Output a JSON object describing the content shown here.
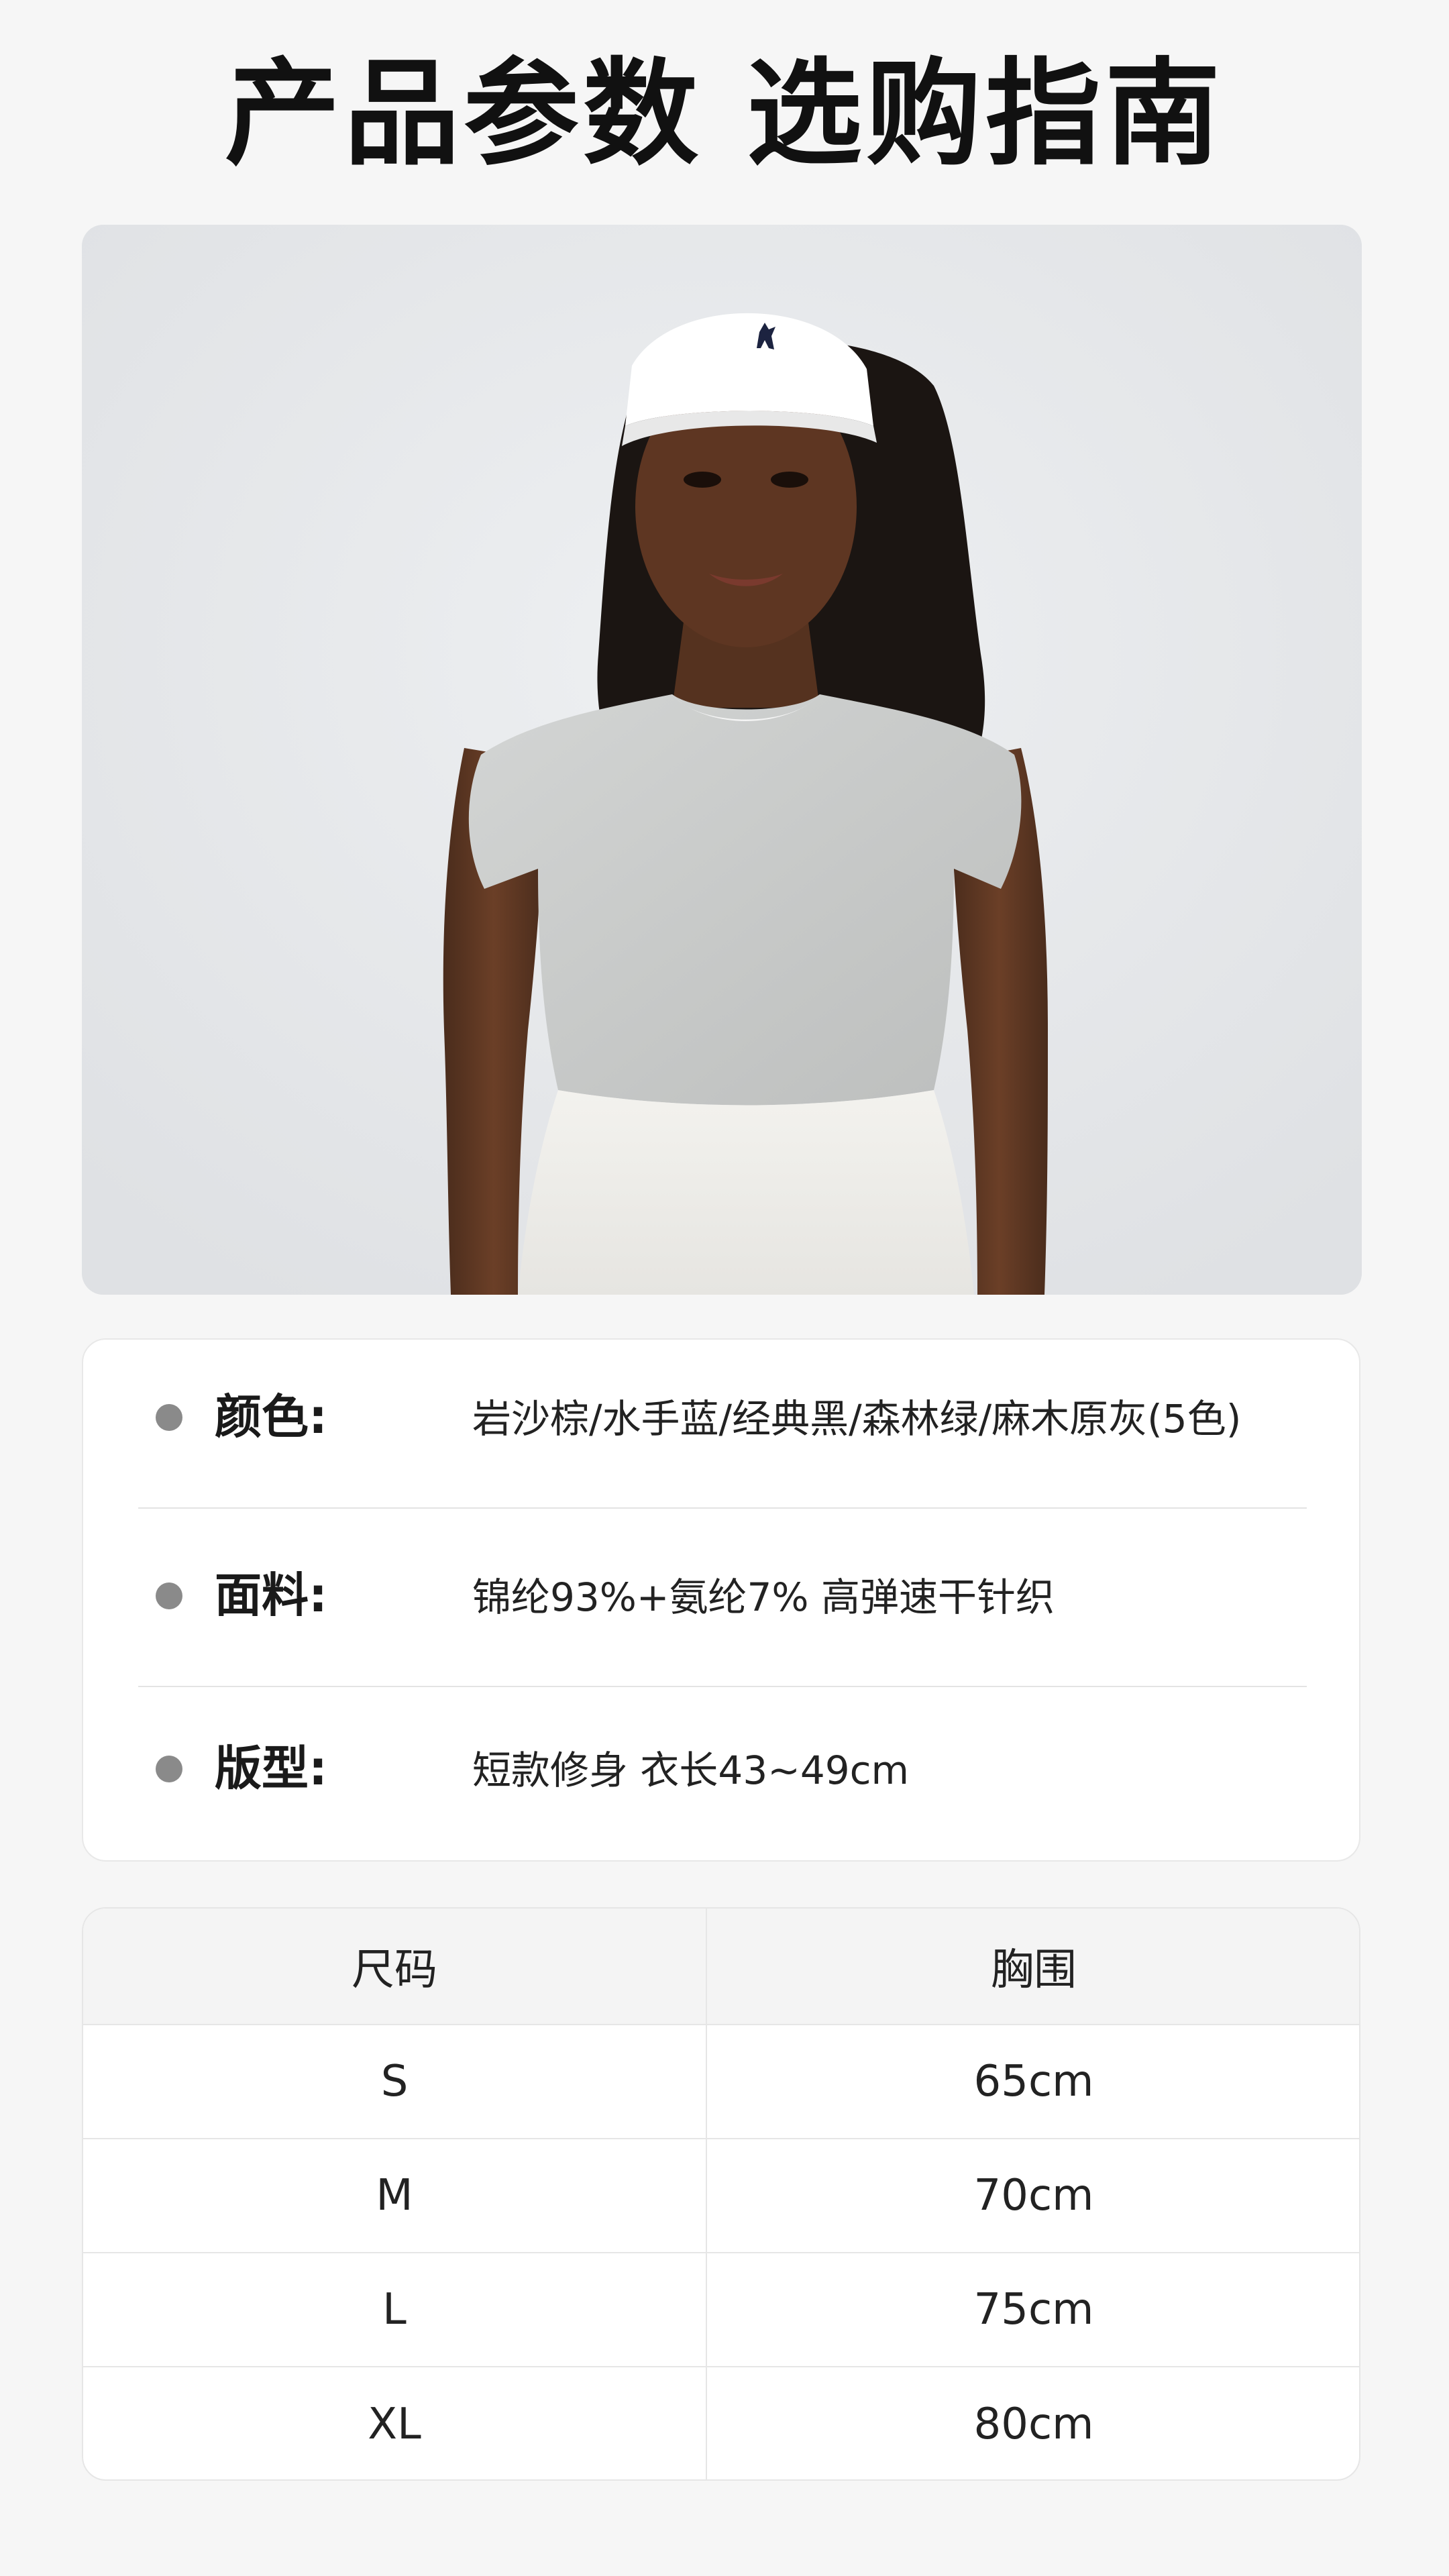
{
  "header": {
    "title": "产品参数 选购指南"
  },
  "colors": {
    "background": "#f6f6f6",
    "card": "#ffffff",
    "bullet": "#8a8a8a",
    "table_header": "#f4f4f4",
    "shirt": "#c9cbca",
    "visor": "#ffffff"
  },
  "photo": {
    "subject": "model-wearing-grey-crop-top-and-white-visor"
  },
  "specs": [
    {
      "label": "颜色:",
      "value": "岩沙棕/水手蓝/经典黑/森林绿/麻木原灰(5色)"
    },
    {
      "label": "面料:",
      "value": "锦纶93%+氨纶7% 高弹速干针织"
    },
    {
      "label": "版型:",
      "value": "短款修身 衣长43~49cm"
    }
  ],
  "size_table": {
    "headers": [
      "尺码",
      "胸围"
    ],
    "rows": [
      [
        "S",
        "65cm"
      ],
      [
        "M",
        "70cm"
      ],
      [
        "L",
        "75cm"
      ],
      [
        "XL",
        "80cm"
      ]
    ]
  }
}
